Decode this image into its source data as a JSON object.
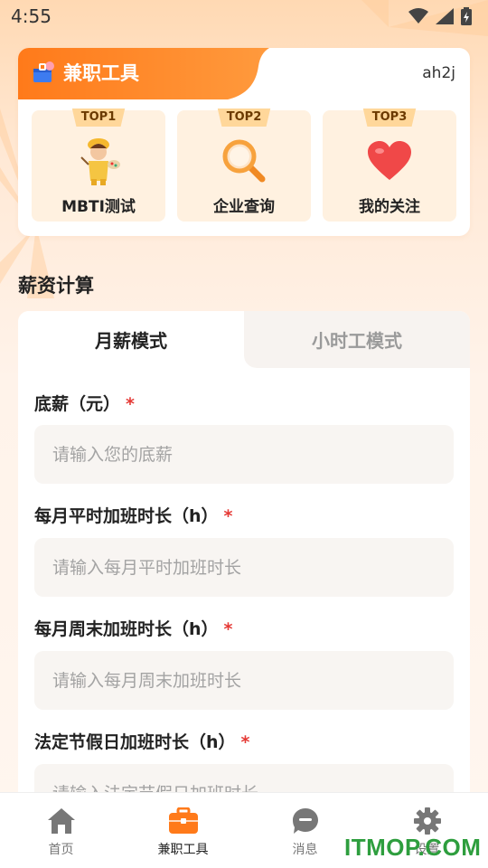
{
  "status_bar": {
    "time": "4:55"
  },
  "tools": {
    "title": "兼职工具",
    "user": "ah2j",
    "items": [
      {
        "badge": "TOP1",
        "label": "MBTI测试",
        "icon": "painter-character-icon"
      },
      {
        "badge": "TOP2",
        "label": "企业查询",
        "icon": "magnifier-icon"
      },
      {
        "badge": "TOP3",
        "label": "我的关注",
        "icon": "heart-icon"
      }
    ]
  },
  "salary": {
    "section_title": "薪资计算",
    "tabs": [
      {
        "label": "月薪模式",
        "active": true
      },
      {
        "label": "小时工模式",
        "active": false
      }
    ],
    "fields": [
      {
        "label": "底薪（元）",
        "required": "*",
        "placeholder": "请输入您的底薪",
        "value": ""
      },
      {
        "label": "每月平时加班时长（h）",
        "required": "*",
        "placeholder": "请输入每月平时加班时长",
        "value": ""
      },
      {
        "label": "每月周末加班时长（h）",
        "required": "*",
        "placeholder": "请输入每月周末加班时长",
        "value": ""
      },
      {
        "label": "法定节假日加班时长（h）",
        "required": "*",
        "placeholder": "请输入法定节假日加班时长",
        "value": ""
      }
    ]
  },
  "nav": {
    "items": [
      {
        "label": "首页",
        "icon": "home-icon",
        "active": false
      },
      {
        "label": "兼职工具",
        "icon": "briefcase-icon",
        "active": true
      },
      {
        "label": "消息",
        "icon": "message-icon",
        "active": false
      },
      {
        "label": "设置",
        "icon": "gear-icon",
        "active": false
      }
    ]
  },
  "watermark": "ITMOP.COM",
  "colors": {
    "accent": "#ff7a1a",
    "required": "#e53935",
    "watermark": "#2e9e3e"
  }
}
